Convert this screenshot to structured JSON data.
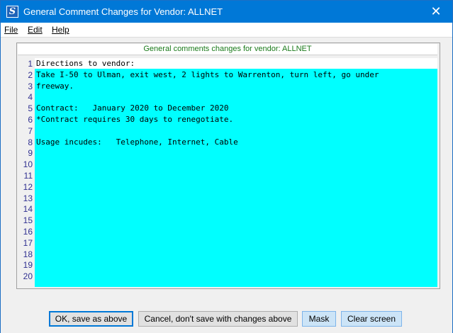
{
  "window": {
    "title": "General Comment Changes for Vendor: ALLNET",
    "close_glyph": "✕",
    "app_icon_letter": "S"
  },
  "menu": {
    "file": "File",
    "edit": "Edit",
    "help": "Help"
  },
  "panel": {
    "header": "General comments changes for vendor: ALLNET"
  },
  "editor": {
    "lines": [
      {
        "num": "1",
        "text": "Directions to vendor:"
      },
      {
        "num": "2",
        "text": "Take I-50 to Ulman, exit west, 2 lights to Warrenton, turn left, go under"
      },
      {
        "num": "3",
        "text": "freeway."
      },
      {
        "num": "4",
        "text": ""
      },
      {
        "num": "5",
        "text": "Contract:   January 2020 to December 2020"
      },
      {
        "num": "6",
        "text": "*Contract requires 30 days to renegotiate."
      },
      {
        "num": "7",
        "text": ""
      },
      {
        "num": "8",
        "text": "Usage incudes:   Telephone, Internet, Cable"
      },
      {
        "num": "9",
        "text": ""
      },
      {
        "num": "10",
        "text": ""
      },
      {
        "num": "11",
        "text": ""
      },
      {
        "num": "12",
        "text": ""
      },
      {
        "num": "13",
        "text": ""
      },
      {
        "num": "14",
        "text": ""
      },
      {
        "num": "15",
        "text": ""
      },
      {
        "num": "16",
        "text": ""
      },
      {
        "num": "17",
        "text": ""
      },
      {
        "num": "18",
        "text": ""
      },
      {
        "num": "19",
        "text": ""
      },
      {
        "num": "20",
        "text": ""
      }
    ]
  },
  "buttons": {
    "ok": "OK, save as above",
    "cancel": "Cancel, don't save with changes above",
    "mask": "Mask",
    "clear": "Clear screen"
  },
  "colors": {
    "titlebar": "#0078d7",
    "editor_bg": "#00ffff",
    "header_text": "#1a7a1a"
  }
}
